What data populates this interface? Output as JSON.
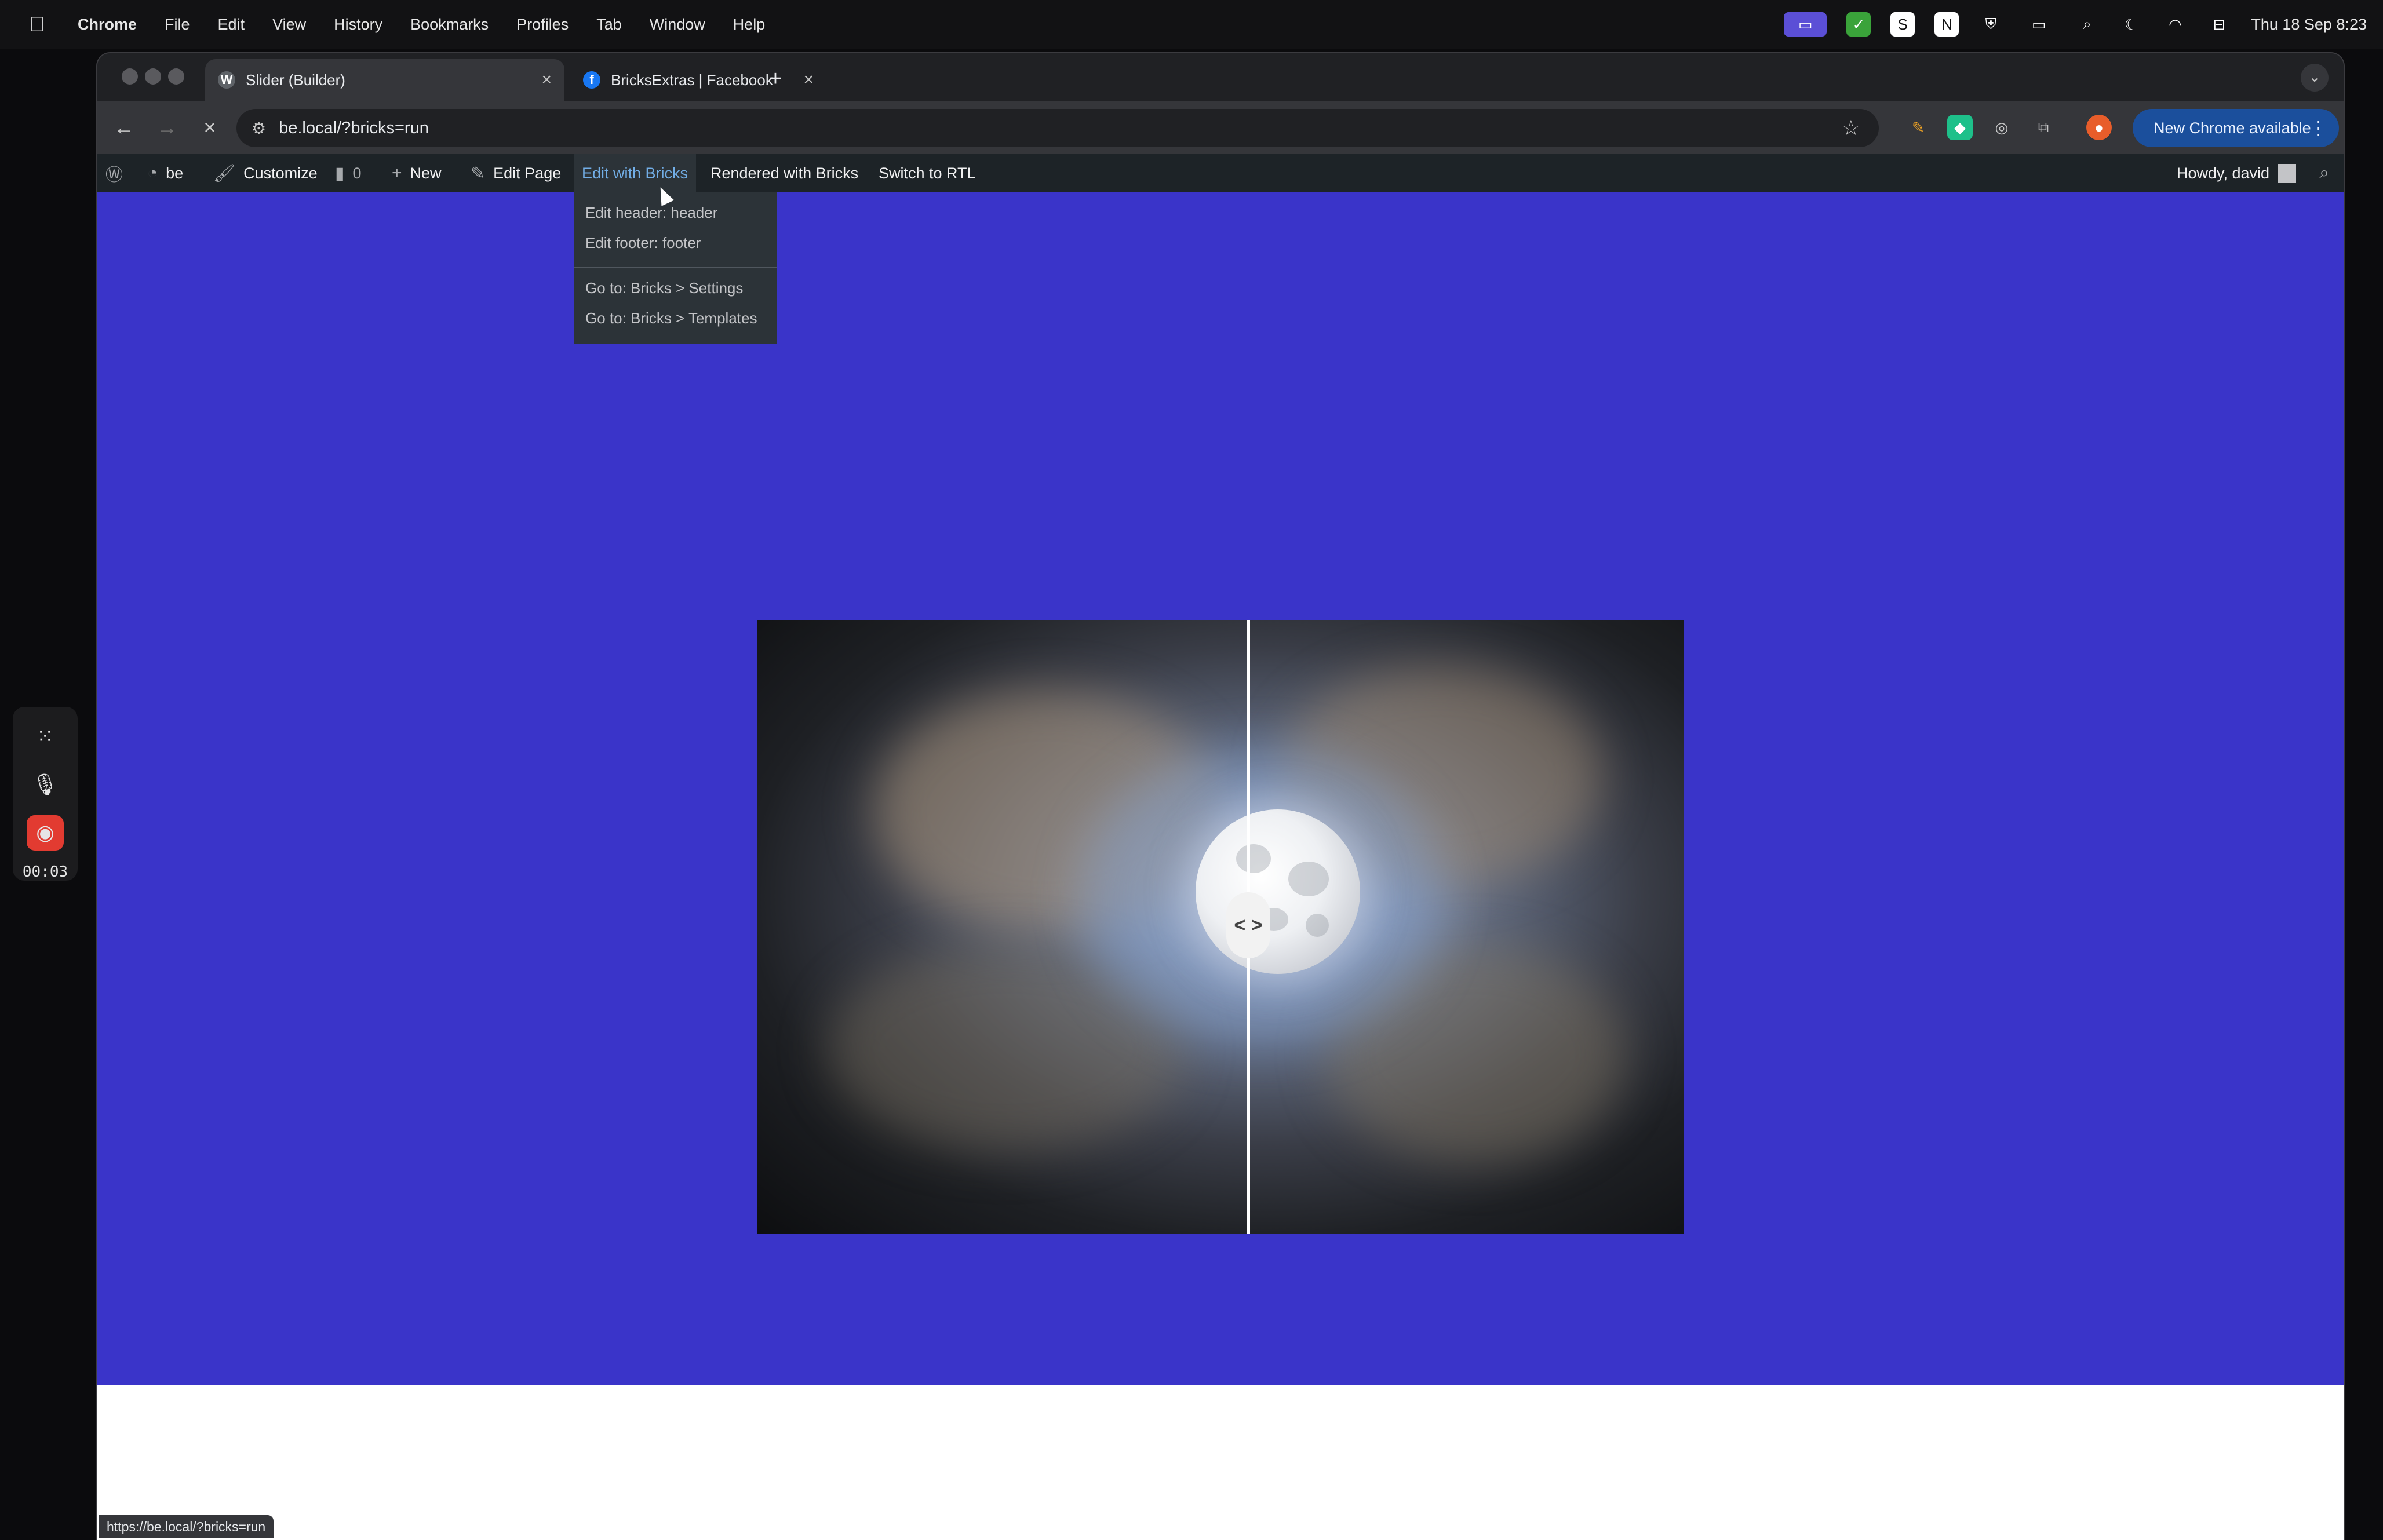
{
  "menubar": {
    "apple": "",
    "app": "Chrome",
    "items": [
      "File",
      "Edit",
      "View",
      "History",
      "Bookmarks",
      "Profiles",
      "Tab",
      "Window",
      "Help"
    ],
    "clock": "Thu 18 Sep 8:23"
  },
  "recorder": {
    "time": "00:03"
  },
  "browser": {
    "tabs": [
      {
        "title": "Slider (Builder)",
        "favicon": "W"
      },
      {
        "title": "BricksExtras | Facebook",
        "favicon": "f"
      }
    ],
    "url": "be.local/?bricks=run",
    "update_label": "New Chrome available",
    "status_url": "https://be.local/?bricks=run"
  },
  "adminbar": {
    "site": "be",
    "customize": "Customize",
    "comments": "0",
    "new": "New",
    "edit_page": "Edit Page",
    "edit_with_bricks": "Edit with Bricks",
    "rendered": "Rendered with Bricks",
    "rtl": "Switch to RTL",
    "howdy": "Howdy, david"
  },
  "dropdown": {
    "items": [
      "Edit header: header",
      "Edit footer: footer",
      "Go to: Bricks > Settings",
      "Go to: Bricks > Templates"
    ]
  },
  "colors": {
    "hero_bg": "#3a34c9",
    "adminbar_bg": "#1d2327",
    "accent_link": "#72aee6"
  },
  "compare": {
    "handle": "< >"
  }
}
